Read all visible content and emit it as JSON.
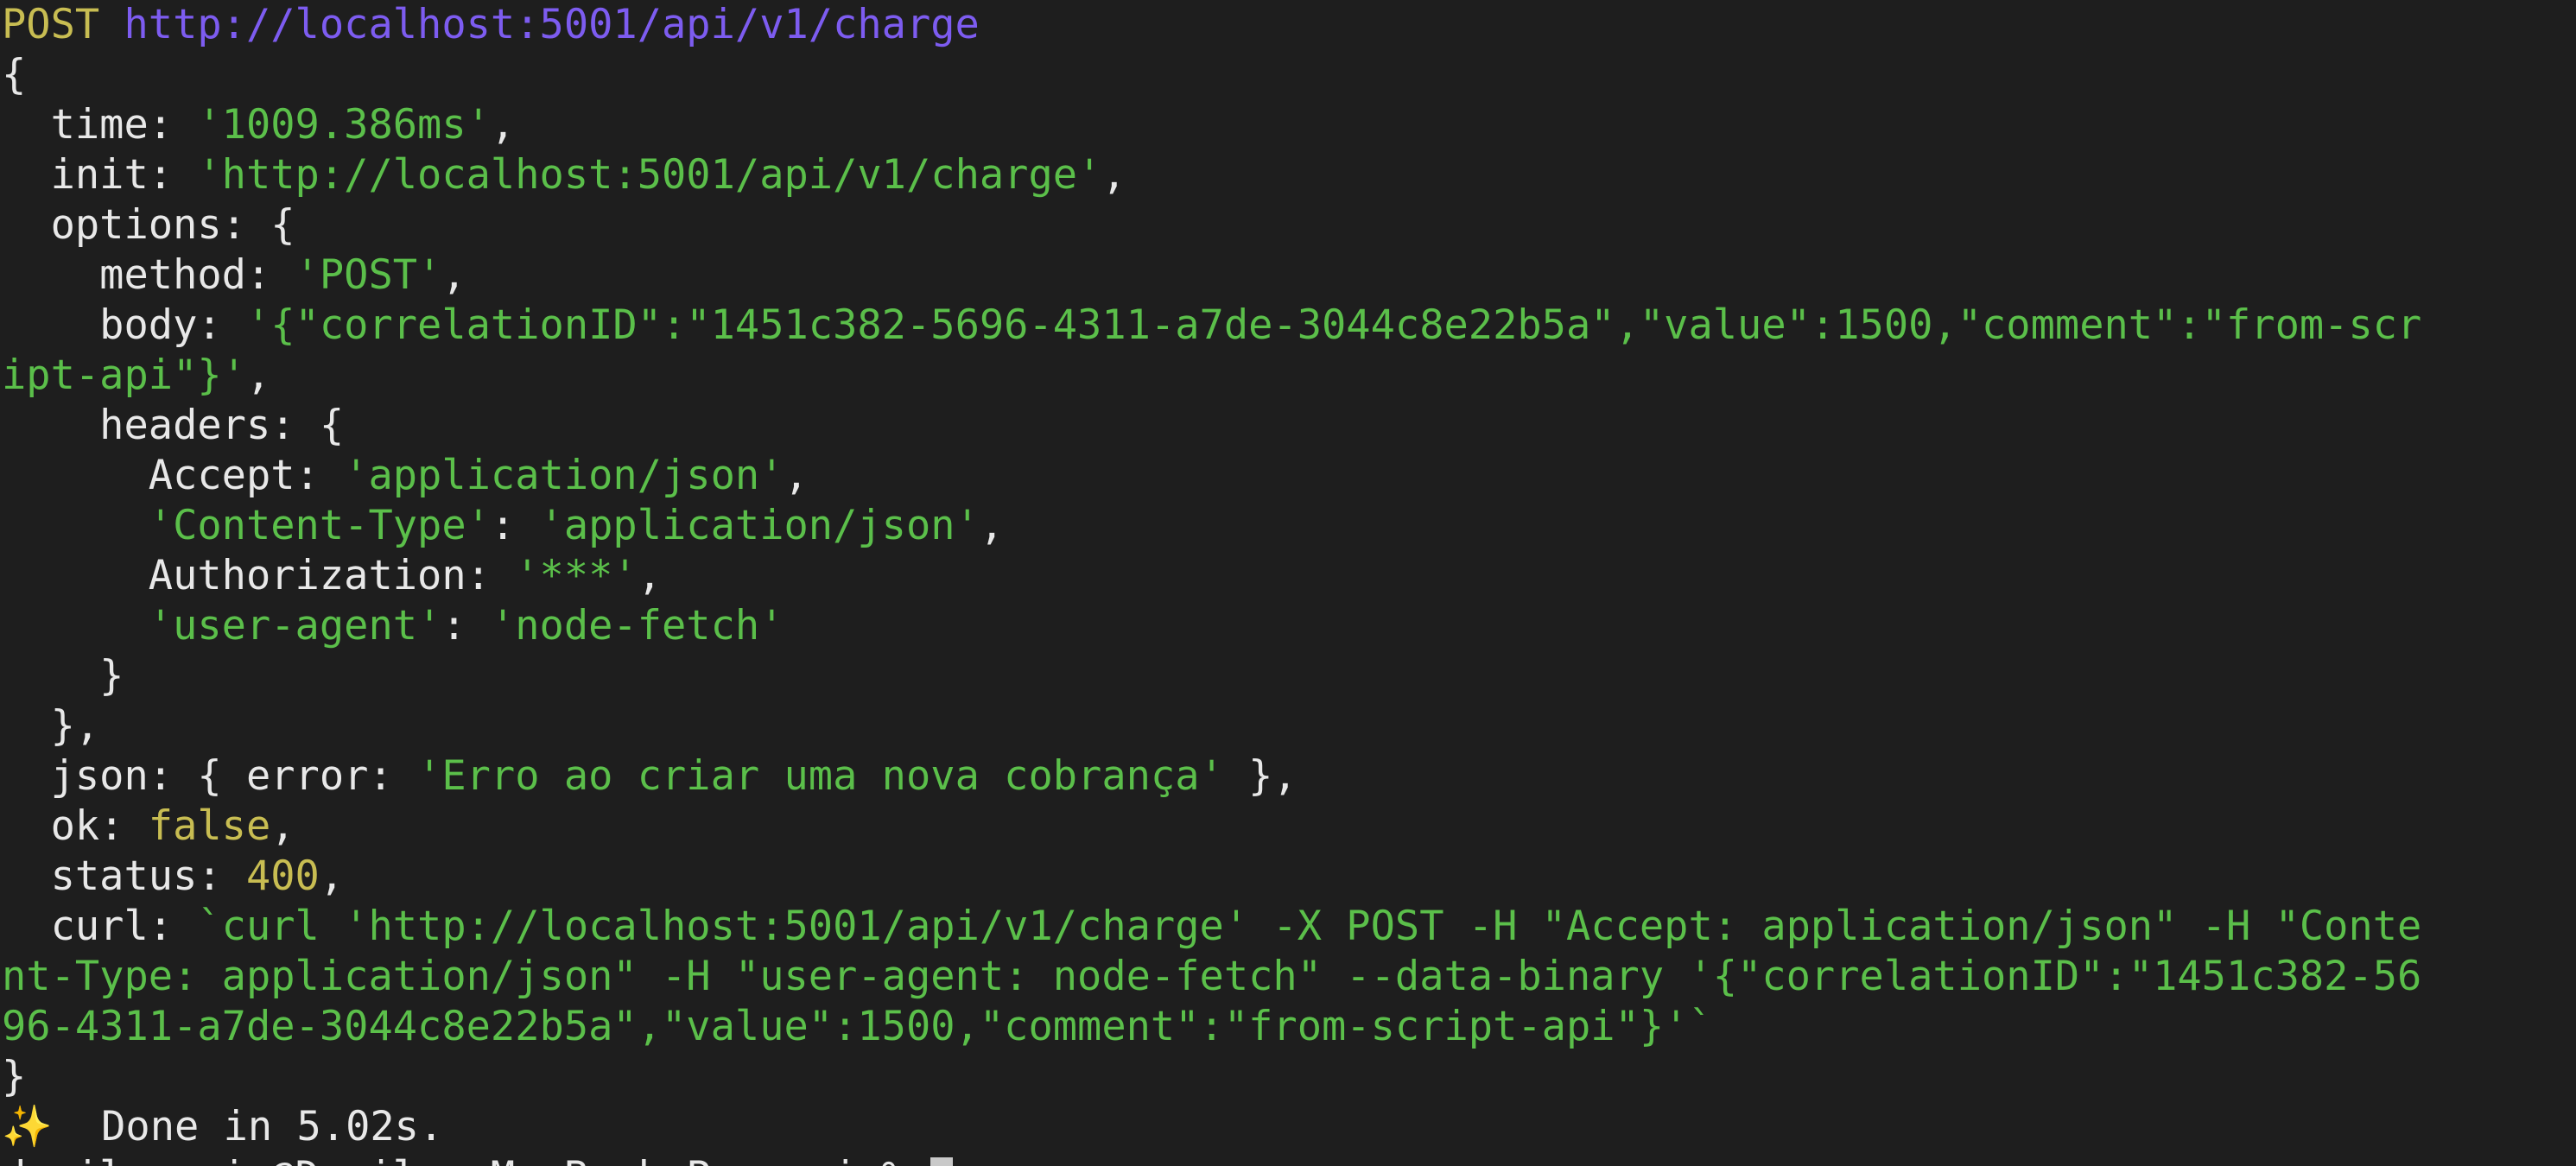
{
  "request_line": {
    "method": "POST",
    "url": "http://localhost:5001/api/v1/charge"
  },
  "output": {
    "open_brace": "{",
    "time_key": "  time: ",
    "time_val": "'1009.386ms'",
    "init_key": "  init: ",
    "init_val": "'http://localhost:5001/api/v1/charge'",
    "options_key": "  options: {",
    "method_key": "    method: ",
    "method_val": "'POST'",
    "body_key": "    body: ",
    "body_val_1": "'{\"correlationID\":\"1451c382-5696-4311-a7de-3044c8e22b5a\",\"value\":1500,\"comment\":\"from-scr",
    "body_val_2": "ipt-api\"}'",
    "headers_key": "    headers: {",
    "accept_key": "      Accept: ",
    "accept_val": "'application/json'",
    "ctype_key": "'Content-Type'",
    "ctype_val": "'application/json'",
    "auth_key": "      Authorization: ",
    "auth_val": "'***'",
    "ua_key": "'user-agent'",
    "ua_val": "'node-fetch'",
    "headers_close": "    }",
    "options_close": "  },",
    "json_key": "  json: { error: ",
    "json_val": "'Erro ao criar uma nova cobrança'",
    "json_close": " },",
    "ok_key": "  ok: ",
    "ok_val": "false",
    "status_key": "  status: ",
    "status_val": "400",
    "curl_key": "  curl: ",
    "curl_1": "`curl 'http://localhost:5001/api/v1/charge' -X POST -H \"Accept: application/json\" -H \"Conte",
    "curl_2": "nt-Type: application/json\" -H \"user-agent: node-fetch\" --data-binary '{\"correlationID\":\"1451c382-56",
    "curl_3": "96-4311-a7de-3044c8e22b5a\",\"value\":1500,\"comment\":\"from-script-api\"}'`",
    "close_brace": "}"
  },
  "done": {
    "icon": "sparkles-icon",
    "text": "  Done in 5.02s."
  },
  "prompt": {
    "text": "daniloassis@Danilos-MacBook-Pro api % "
  },
  "colors": {
    "background": "#1e1e1e",
    "string": "#5bbf4a",
    "keyword": "#c8bd52",
    "url": "#7d5cf0",
    "text": "#e8e8e8"
  }
}
